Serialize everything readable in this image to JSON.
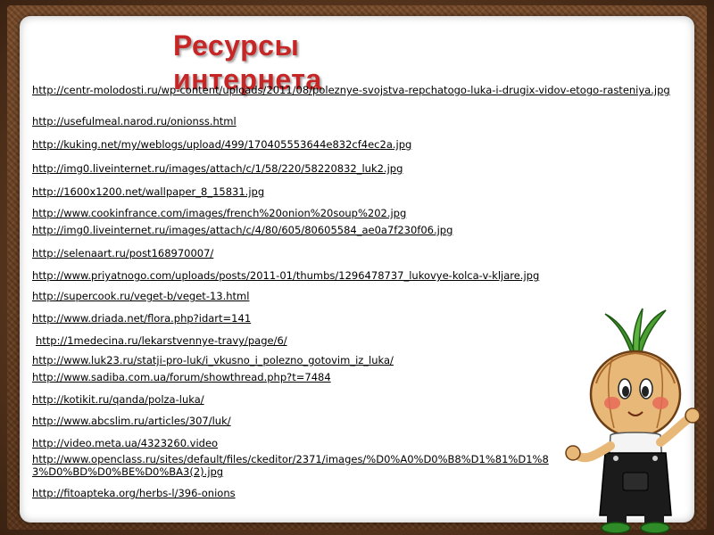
{
  "title": "Ресурсы интернета",
  "links": [
    "http://centr-molodosti.ru/wp-content/uploads/2011/08/poleznye-svojstva-repchatogo-luka-i-drugix-vidov-etogo-rasteniya.jpg",
    "http://usefulmeal.narod.ru/onionss.html",
    "http://kuking.net/my/weblogs/upload/499/170405553644e832cf4ec2a.jpg",
    "http://img0.liveinternet.ru/images/attach/c/1/58/220/58220832_luk2.jpg",
    "http://1600x1200.net/wallpaper_8_15831.jpg",
    "http://www.cookinfrance.com/images/french%20onion%20soup%202.jpg",
    "http://img0.liveinternet.ru/images/attach/c/4/80/605/80605584_ae0a7f230f06.jpg",
    "http://selenaart.ru/post168970007/",
    "http://www.priyatnogo.com/uploads/posts/2011-01/thumbs/1296478737_lukovye-kolca-v-kljare.jpg",
    "http://supercook.ru/veget-b/veget-13.html",
    "http://www.driada.net/flora.php?idart=141",
    "http://1medecina.ru/lekarstvennye-travy/page/6/",
    "http://www.luk23.ru/statji-pro-luk/i_vkusno_i_polezno_gotovim_iz_luka/",
    "http://www.sadiba.com.ua/forum/showthread.php?t=7484",
    "http://kotikit.ru/qanda/polza-luka/",
    "http://www.abcslim.ru/articles/307/luk/",
    "http://video.meta.ua/4323260.video",
    "http://www.openclass.ru/sites/default/files/ckeditor/2371/images/%D0%A0%D0%B8%D1%81%D1%83%D0%BD%D0%BE%D0%BA3(2).jpg",
    "http://fitoapteka.org/herbs-l/396-onions"
  ]
}
